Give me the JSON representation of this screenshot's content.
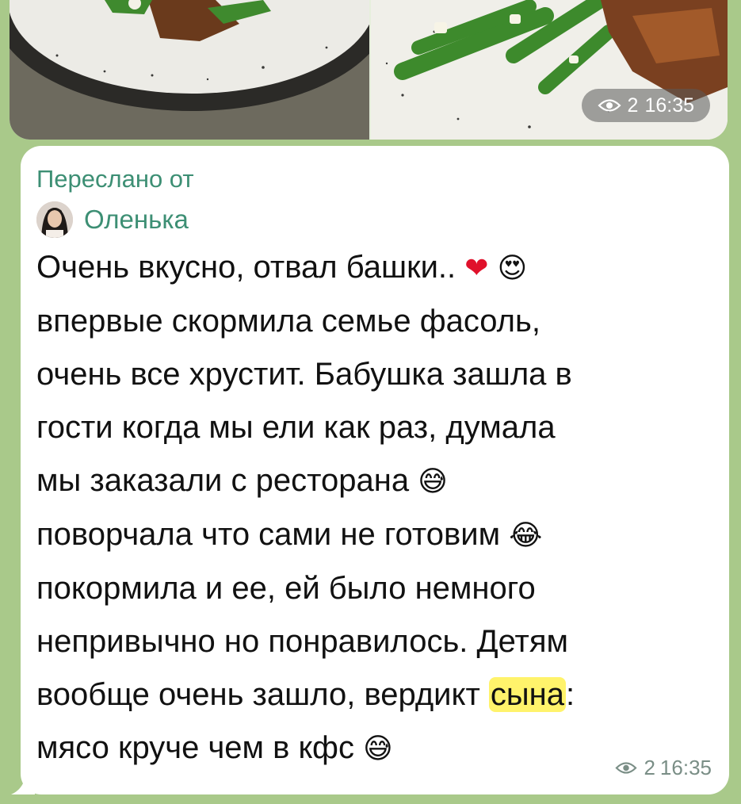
{
  "photo_message": {
    "views": "2",
    "time": "16:35"
  },
  "text_message": {
    "forwarded_label": "Переслано от",
    "forwarded_from": "Оленька",
    "lines": {
      "l1": "Очень вкусно, отвал башки..",
      "l1_emoji_a": "❤",
      "l1_emoji_b": "😍",
      "l2": "впервые скормила семье фасоль,",
      "l3": "очень все хрустит. Бабушка зашла в",
      "l4": "гости когда мы ели как раз, думала",
      "l5": "мы заказали с ресторана",
      "l5_emoji": "😅",
      "l6": "поворчала что сами не готовим",
      "l6_emoji": "😂",
      "l7": "покормила и ее, ей было немного",
      "l8": "непривычно но понравилось. Детям",
      "l9_a": "вообще очень зашло, вердикт ",
      "l9_hl": "сына",
      "l9_b": ":",
      "l10": "мясо круче чем в кфс",
      "l10_emoji": "😅"
    },
    "views": "2",
    "time": "16:35"
  },
  "colors": {
    "accent": "#3d8f74",
    "chat_background": "#a9c98a",
    "highlight": "#fff36b"
  },
  "icons": {
    "views": "eye-icon"
  }
}
